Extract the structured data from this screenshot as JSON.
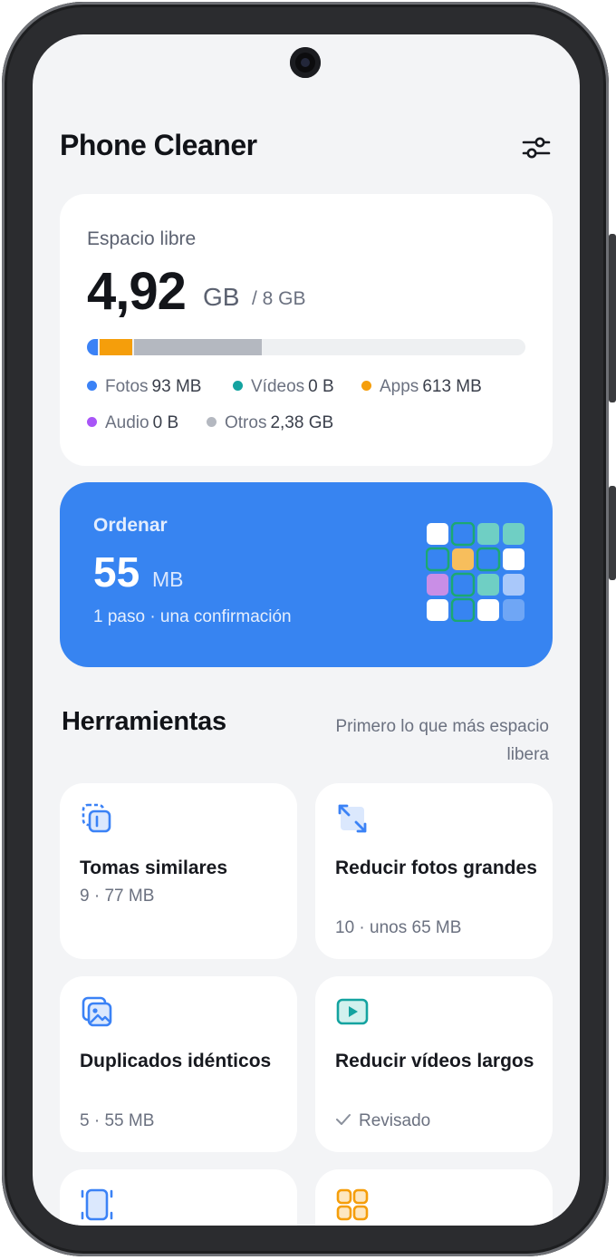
{
  "app": {
    "title": "Phone Cleaner"
  },
  "icons": {
    "settings": "sliders-icon",
    "similar": "similar-shots-icon",
    "resize": "resize-arrows-icon",
    "duplicates": "duplicate-images-icon",
    "video": "video-play-icon",
    "screenshot": "screenshot-frame-icon",
    "apps": "apps-grid-icon",
    "check": "check-icon"
  },
  "colors": {
    "accent": "#3784f1",
    "fotos": "#3b82f6",
    "videos": "#14a3a0",
    "apps": "#f59e0b",
    "audio": "#a855f7",
    "otros": "#b4b8c0"
  },
  "storage": {
    "label": "Espacio libre",
    "free_value": "4,92",
    "free_unit": "GB",
    "total": "/ 8 GB",
    "bar_fraction_used": {
      "fotos": 0.0114,
      "videos": 0,
      "apps": 0.0748,
      "audio": 0,
      "otros": 0.2905
    },
    "legend": [
      {
        "name": "Fotos",
        "value": "93 MB"
      },
      {
        "name": "Vídeos",
        "value": "0 B"
      },
      {
        "name": "Apps",
        "value": "613 MB"
      },
      {
        "name": "Audio",
        "value": "0 B"
      },
      {
        "name": "Otros",
        "value": "2,38 GB"
      }
    ]
  },
  "sort": {
    "label": "Ordenar",
    "value": "55",
    "unit": "MB",
    "subtitle": "1 paso · una confirmación"
  },
  "tools_section": {
    "title": "Herramientas",
    "hint": "Primero lo que más espacio libera"
  },
  "tools": [
    {
      "title": "Tomas similares",
      "meta": "9 · 77 MB"
    },
    {
      "title": "Reducir fotos grandes",
      "meta": "10 · unos 65 MB"
    },
    {
      "title": "Duplicados idénticos",
      "meta": "5 · 55 MB"
    },
    {
      "title": "Reducir vídeos largos",
      "meta": "Revisado"
    }
  ]
}
